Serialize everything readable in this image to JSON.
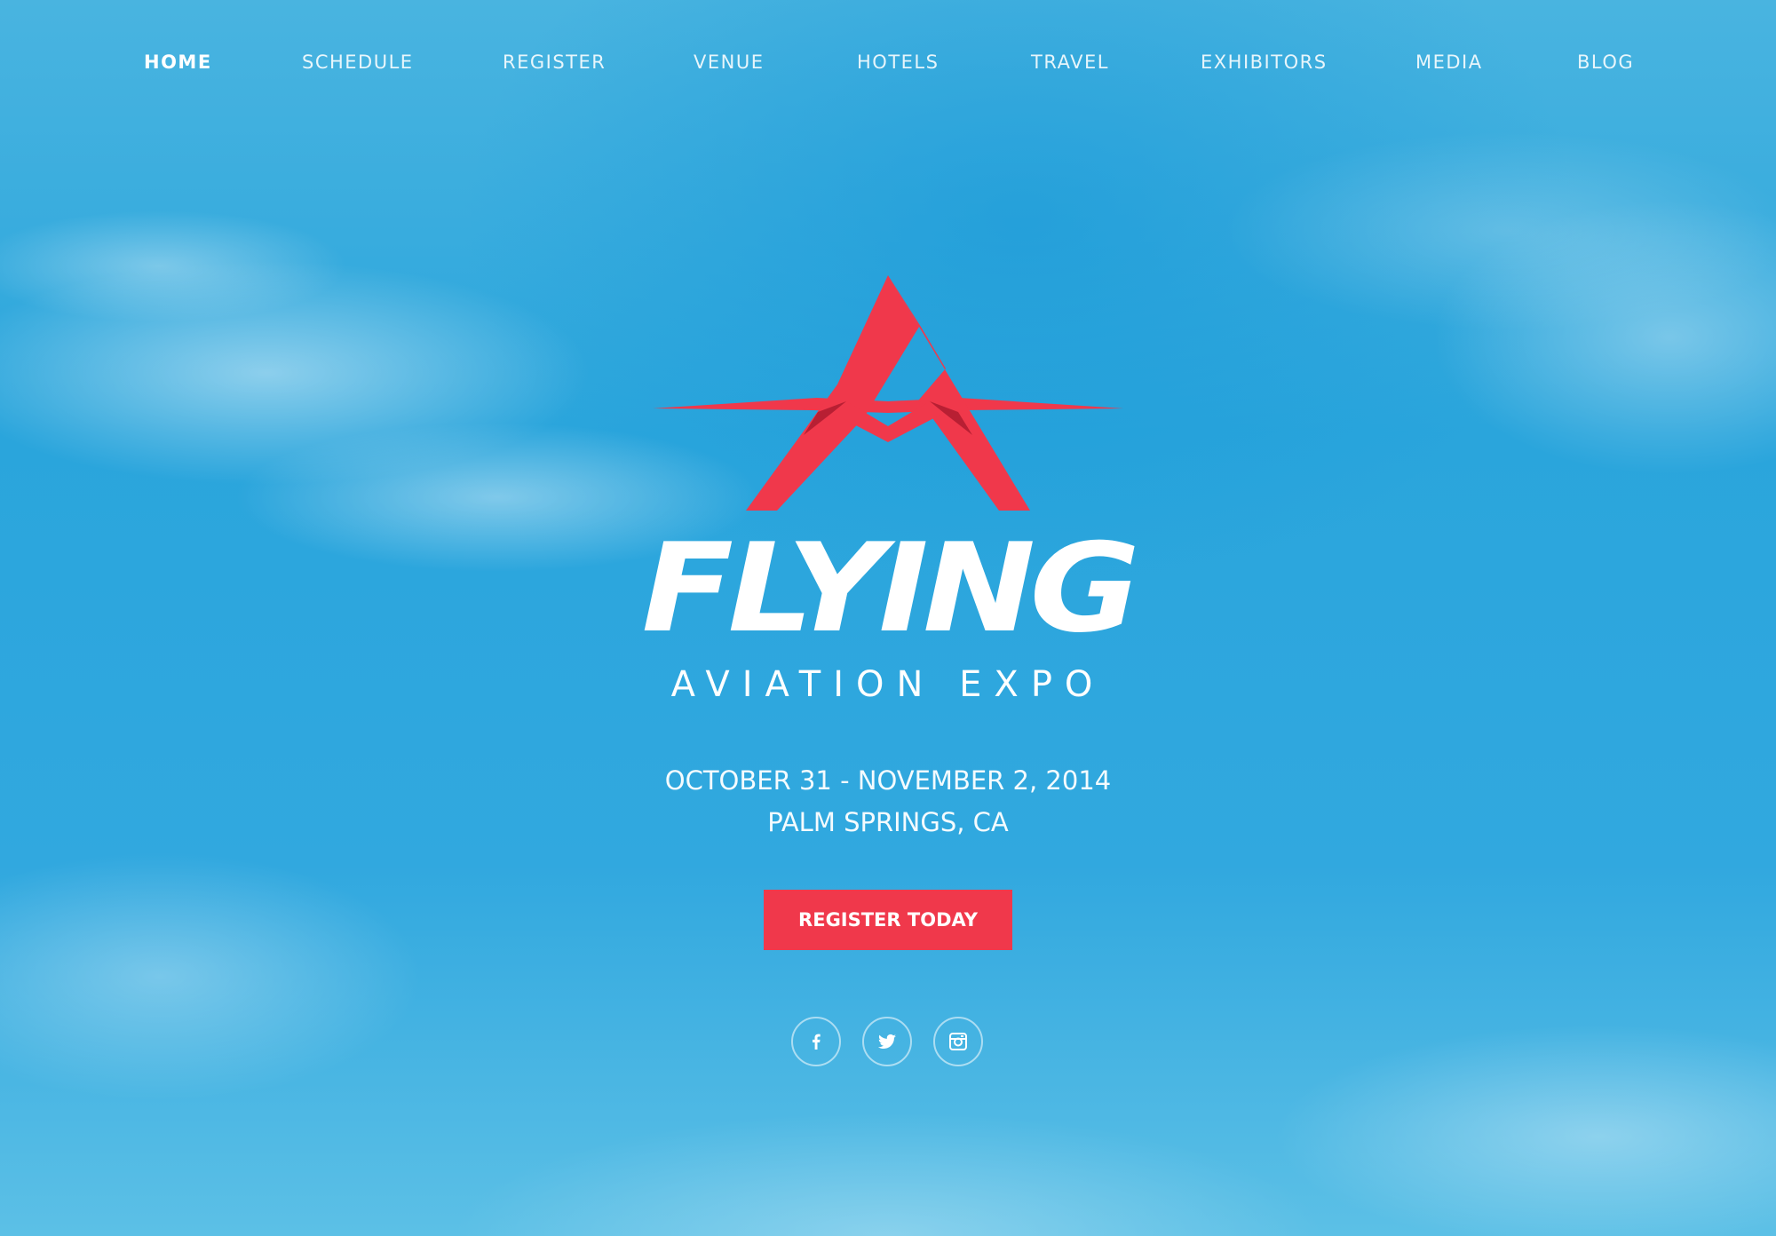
{
  "nav": {
    "items": [
      {
        "label": "HOME",
        "active": true
      },
      {
        "label": "SCHEDULE",
        "active": false
      },
      {
        "label": "REGISTER",
        "active": false
      },
      {
        "label": "VENUE",
        "active": false
      },
      {
        "label": "HOTELS",
        "active": false
      },
      {
        "label": "TRAVEL",
        "active": false
      },
      {
        "label": "EXHIBITORS",
        "active": false
      },
      {
        "label": "MEDIA",
        "active": false
      },
      {
        "label": "BLOG",
        "active": false
      }
    ]
  },
  "hero": {
    "logo_icon": "plane-a-logo-icon",
    "wordmark": "FLYING",
    "subtitle": "AVIATION EXPO",
    "dates": "OCTOBER 31 - NOVEMBER 2, 2014",
    "location": "PALM SPRINGS, CA",
    "cta_label": "REGISTER TODAY"
  },
  "social": [
    {
      "icon": "facebook-icon"
    },
    {
      "icon": "twitter-icon"
    },
    {
      "icon": "instagram-icon"
    }
  ],
  "colors": {
    "accent": "#f0384b",
    "accent_dark": "#b81f33",
    "sky": "#2fa6dc",
    "text": "#ffffff"
  }
}
